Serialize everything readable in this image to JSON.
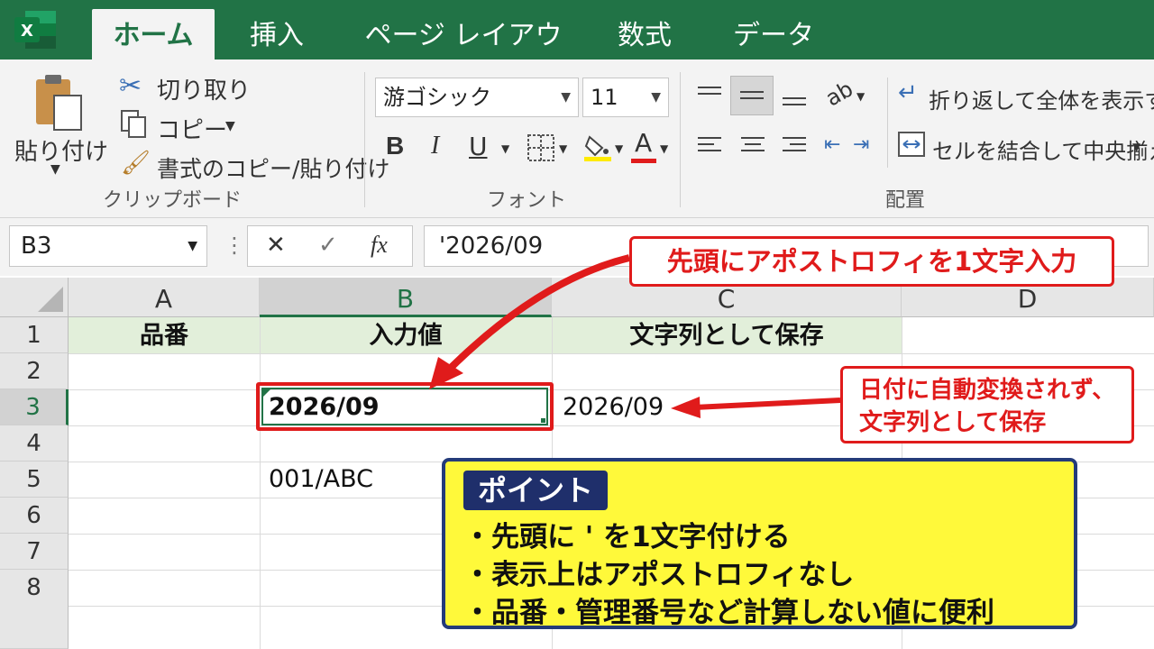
{
  "tabs": [
    "ホーム",
    "挿入",
    "ページ レイアウト",
    "数式",
    "データ"
  ],
  "ribbon": {
    "paste_label": "貼り付け",
    "cut_label": "切り取り",
    "copy_label": "コピー",
    "format_painter_label": "書式のコピー/貼り付け",
    "clipboard_group": "クリップボード",
    "font_name": "游ゴシック",
    "font_size": "11",
    "bold": "B",
    "italic": "I",
    "underline": "U",
    "font_color": "A",
    "font_group": "フォント",
    "wrap_text_label": "折り返して全体を表示する",
    "merge_center_label": "セルを結合して中央揃え",
    "alignment_group": "配置"
  },
  "formula_bar": {
    "name_box": "B3",
    "cancel": "✕",
    "enter": "✓",
    "fx": "fx",
    "formula": "'2026/09"
  },
  "columns": [
    "A",
    "B",
    "C",
    "D"
  ],
  "rows": [
    "1",
    "2",
    "3",
    "4",
    "5",
    "6",
    "7",
    "8"
  ],
  "cells": {
    "A1": "品番",
    "B1": "入力値",
    "C1": "文字列として保存",
    "B3": "2026/09",
    "C3": "2026/09",
    "B5": "001/ABC"
  },
  "annotations": {
    "top": "先頭にアポストロフィを1文字入力",
    "right_line1": "日付に自動変換されず、",
    "right_line2": "文字列として保存",
    "point_title": "ポイント",
    "point_items": [
      "・先頭に ' を1文字付ける",
      "・表示上はアポストロフィなし",
      "・品番・管理番号など計算しない値に便利"
    ]
  },
  "colors": {
    "excel_green": "#217346",
    "annotation_red": "#e01b1b",
    "point_yellow": "#fff93a",
    "point_navy": "#1f2f6b",
    "header_fill": "#e2efda"
  }
}
